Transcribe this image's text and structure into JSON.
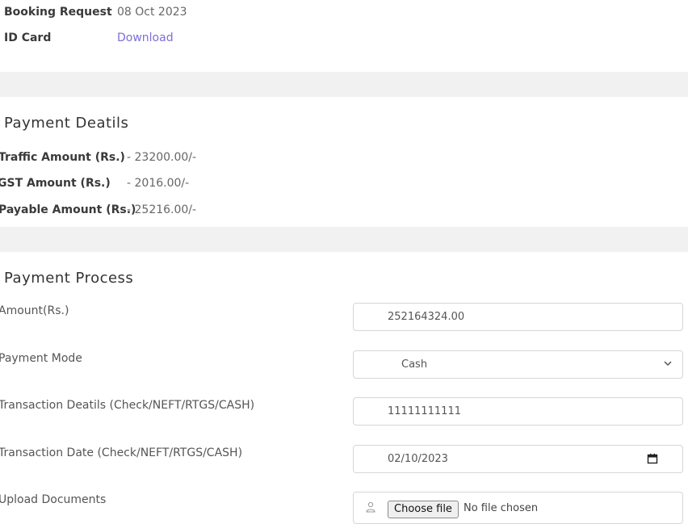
{
  "booking": {
    "request_label": "Booking Request",
    "request_value": "08 Oct 2023",
    "idcard_label": "ID Card",
    "idcard_link": "Download"
  },
  "payment_details": {
    "title": "Payment Deatils",
    "rows": [
      {
        "label": "Traffic Amount (Rs.)",
        "value": "- 23200.00/-"
      },
      {
        "label": "GST Amount (Rs.)",
        "value": "- 2016.00/-"
      },
      {
        "label": "Payable Amount (Rs.)",
        "value": "- 25216.00/-"
      }
    ]
  },
  "payment_process": {
    "title": "Payment Process",
    "amount_label": "Amount(Rs.)",
    "amount_value": "252164324.00",
    "mode_label": "Payment Mode",
    "mode_value": "Cash",
    "transaction_label": "Transaction Deatils (Check/NEFT/RTGS/CASH)",
    "transaction_value": "11111111111",
    "date_label": "Transaction Date (Check/NEFT/RTGS/CASH)",
    "date_value": "02/10/2023",
    "upload_label": "Upload Documents",
    "choose_file": "Choose file",
    "no_file": "No file chosen"
  },
  "icons": {
    "chevron": "chevron-down-icon",
    "calendar": "calendar-icon",
    "person": "person-icon"
  },
  "colors": {
    "link": "#7b6fd6",
    "band": "#f1f1f1",
    "border": "#d6d6d6"
  }
}
